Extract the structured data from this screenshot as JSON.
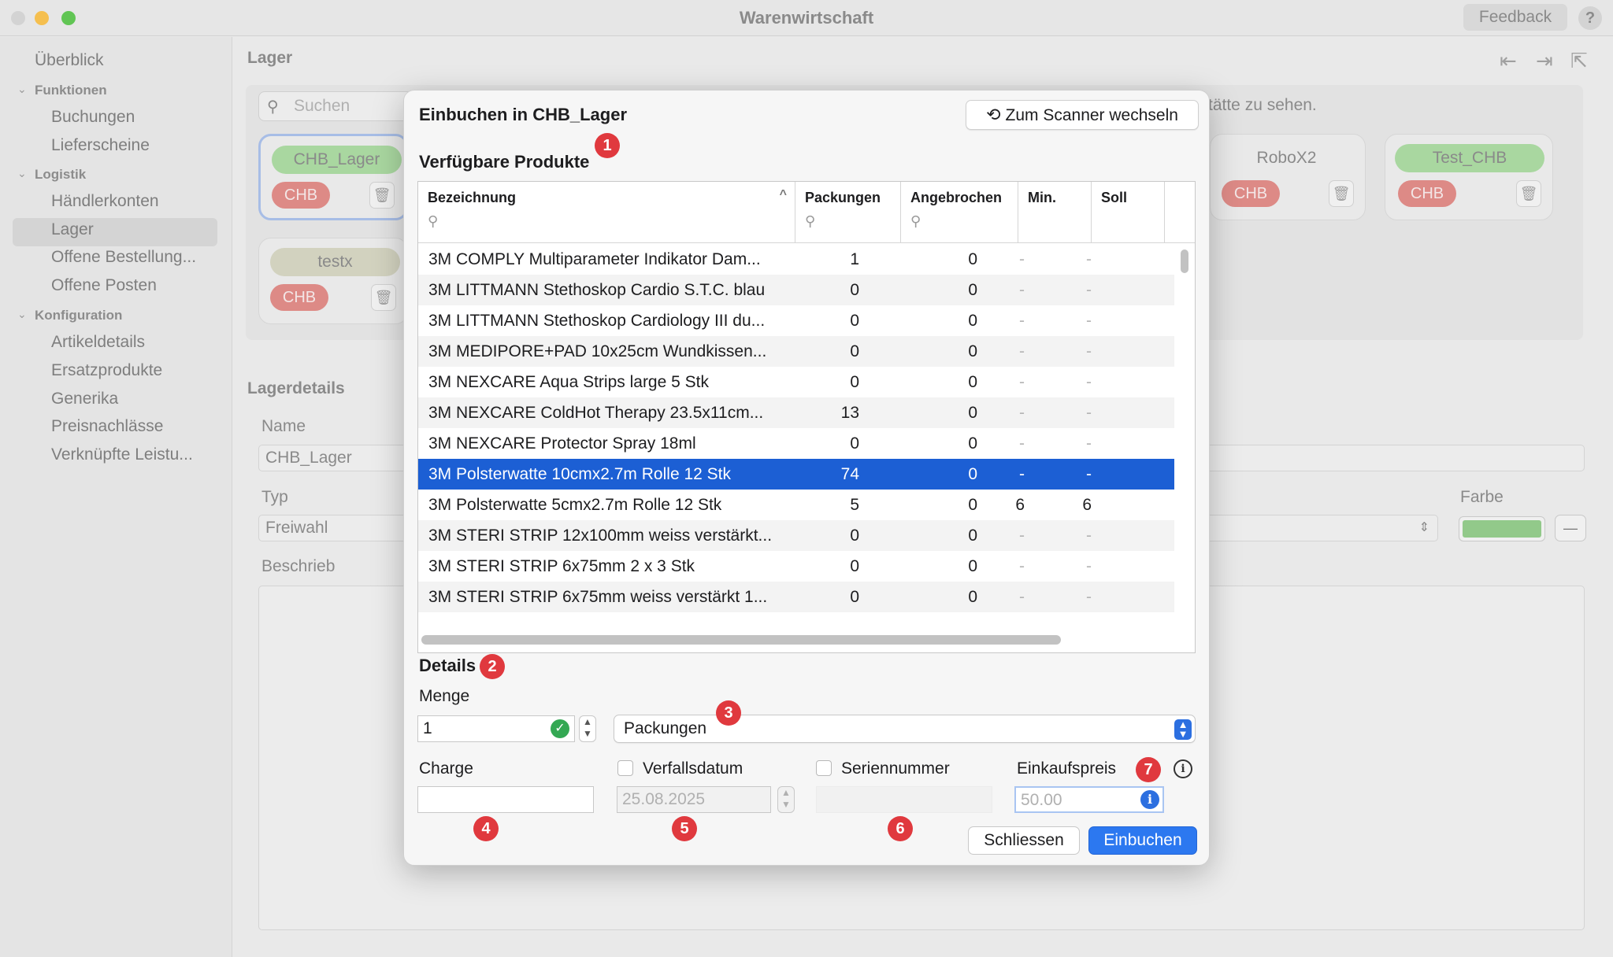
{
  "window": {
    "title": "Warenwirtschaft",
    "feedback_label": "Feedback",
    "help_label": "?"
  },
  "sidebar": {
    "overview": "Überblick",
    "sections": [
      {
        "label": "Funktionen",
        "items": [
          "Buchungen",
          "Lieferscheine"
        ]
      },
      {
        "label": "Logistik",
        "items": [
          "Händlerkonten",
          "Lager",
          "Offene Bestellung...",
          "Offene Posten"
        ]
      },
      {
        "label": "Konfiguration",
        "items": [
          "Artikeldetails",
          "Ersatzprodukte",
          "Generika",
          "Preisnachlässe",
          "Verknüpfte Leistu..."
        ]
      }
    ],
    "selected_item": "Lager"
  },
  "main": {
    "section_title": "Lager",
    "search_placeholder": "Suchen",
    "hint_text": "tätte zu sehen.",
    "cards": [
      {
        "name": "CHB_Lager",
        "tag": "CHB",
        "name_color": "#a9d7a0"
      },
      {
        "name": "testx",
        "tag": "CHB",
        "name_color": "#d2d2bf"
      },
      {
        "name": "RoboX2",
        "tag": "CHB",
        "name_color": "#e9e9e9"
      },
      {
        "name": "Test_CHB",
        "tag": "CHB",
        "name_color": "#a9d7a0"
      }
    ],
    "details_title": "Lagerdetails",
    "name_label": "Name",
    "name_value": "CHB_Lager",
    "type_label": "Typ",
    "type_value": "Freiwahl",
    "description_label": "Beschrieb",
    "color_label": "Farbe",
    "color_value": "#92c98a",
    "remove_label": "—"
  },
  "modal": {
    "title": "Einbuchen in CHB_Lager",
    "scanner_button": "Zum Scanner wechseln",
    "products_title": "Verfügbare Produkte",
    "details_title": "Details",
    "badges": [
      "1",
      "2",
      "3",
      "4",
      "5",
      "6",
      "7"
    ],
    "table": {
      "columns": [
        "Bezeichnung",
        "Packungen",
        "Angebrochen",
        "Min.",
        "Soll"
      ],
      "rows": [
        {
          "name": "3M COMPLY Multiparameter Indikator Dam...",
          "packungen": "1",
          "angebrochen": "0",
          "min": "-",
          "soll": "-"
        },
        {
          "name": "3M LITTMANN Stethoskop Cardio S.T.C. blau",
          "packungen": "0",
          "angebrochen": "0",
          "min": "-",
          "soll": "-"
        },
        {
          "name": "3M LITTMANN Stethoskop Cardiology III du...",
          "packungen": "0",
          "angebrochen": "0",
          "min": "-",
          "soll": "-"
        },
        {
          "name": "3M MEDIPORE+PAD 10x25cm Wundkissen...",
          "packungen": "0",
          "angebrochen": "0",
          "min": "-",
          "soll": "-"
        },
        {
          "name": "3M NEXCARE Aqua Strips large 5 Stk",
          "packungen": "0",
          "angebrochen": "0",
          "min": "-",
          "soll": "-"
        },
        {
          "name": "3M NEXCARE ColdHot Therapy 23.5x11cm...",
          "packungen": "13",
          "angebrochen": "0",
          "min": "-",
          "soll": "-"
        },
        {
          "name": "3M NEXCARE Protector Spray 18ml",
          "packungen": "0",
          "angebrochen": "0",
          "min": "-",
          "soll": "-"
        },
        {
          "name": "3M Polsterwatte 10cmx2.7m Rolle 12 Stk",
          "packungen": "74",
          "angebrochen": "0",
          "min": "-",
          "soll": "-",
          "selected": true
        },
        {
          "name": "3M Polsterwatte 5cmx2.7m Rolle 12 Stk",
          "packungen": "5",
          "angebrochen": "0",
          "min": "6",
          "soll": "6"
        },
        {
          "name": "3M STERI STRIP 12x100mm weiss verstärkt...",
          "packungen": "0",
          "angebrochen": "0",
          "min": "-",
          "soll": "-"
        },
        {
          "name": "3M STERI STRIP 6x75mm 2 x 3 Stk",
          "packungen": "0",
          "angebrochen": "0",
          "min": "-",
          "soll": "-"
        },
        {
          "name": "3M STERI STRIP 6x75mm weiss verstärkt 1...",
          "packungen": "0",
          "angebrochen": "0",
          "min": "-",
          "soll": "-"
        }
      ]
    },
    "menge_label": "Menge",
    "menge_value": "1",
    "unit_value": "Packungen",
    "charge_label": "Charge",
    "charge_value": "",
    "verfall_label": "Verfallsdatum",
    "verfall_value": "25.08.2025",
    "serien_label": "Seriennummer",
    "serien_value": "",
    "preis_label": "Einkaufspreis",
    "preis_placeholder": "50.00",
    "close_button": "Schliessen",
    "submit_button": "Einbuchen"
  }
}
